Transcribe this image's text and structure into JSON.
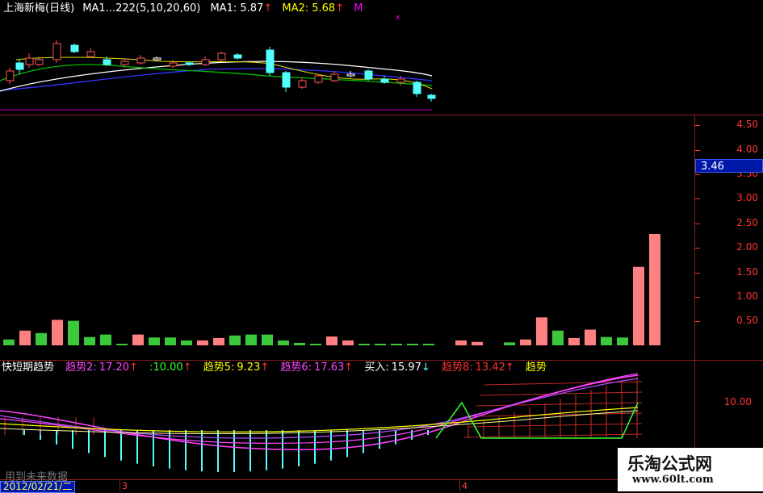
{
  "main_header": {
    "title": "上海新梅(日线)",
    "ma_params": "MA1...222(5,10,20,60)",
    "ma1": "MA1: 5.87",
    "ma1_arrow": "↑",
    "ma2": "MA2: 5.68",
    "ma2_arrow": "↑",
    "ma_more": "M"
  },
  "colors": {
    "bg": "#000000",
    "up": "#ff5555",
    "down": "#54ffff",
    "grid": "#8a1f1f",
    "scale_text": "#ff3333",
    "ma_white": "#ffffff",
    "ma_yellow": "#ffff00",
    "ma_magenta": "#ff00ff",
    "ma_green": "#00c000",
    "ma_blue": "#3333ff",
    "bar_pink": "#ff8080",
    "bar_green": "#3cc83c"
  },
  "volume_scale": {
    "current_value": "3.46",
    "labels": [
      "4.50",
      "4.00",
      "3.50",
      "3.00",
      "2.50",
      "2.00",
      "1.50",
      "1.00",
      "0.50"
    ]
  },
  "volume_bars": [
    {
      "value": 0.12,
      "color": "green"
    },
    {
      "value": 0.3,
      "color": "pink"
    },
    {
      "value": 0.25,
      "color": "green"
    },
    {
      "value": 0.52,
      "color": "pink"
    },
    {
      "value": 0.5,
      "color": "green"
    },
    {
      "value": 0.17,
      "color": "green"
    },
    {
      "value": 0.22,
      "color": "green"
    },
    {
      "value": 0.03,
      "color": "green"
    },
    {
      "value": 0.22,
      "color": "pink"
    },
    {
      "value": 0.16,
      "color": "green"
    },
    {
      "value": 0.16,
      "color": "green"
    },
    {
      "value": 0.1,
      "color": "green"
    },
    {
      "value": 0.1,
      "color": "pink"
    },
    {
      "value": 0.15,
      "color": "pink"
    },
    {
      "value": 0.2,
      "color": "green"
    },
    {
      "value": 0.22,
      "color": "green"
    },
    {
      "value": 0.22,
      "color": "green"
    },
    {
      "value": 0.1,
      "color": "green"
    },
    {
      "value": 0.05,
      "color": "green"
    },
    {
      "value": 0.02,
      "color": "green"
    },
    {
      "value": 0.18,
      "color": "pink"
    },
    {
      "value": 0.1,
      "color": "pink"
    },
    {
      "value": 0.03,
      "color": "green"
    },
    {
      "value": 0.03,
      "color": "green"
    },
    {
      "value": 0.03,
      "color": "green"
    },
    {
      "value": 0.03,
      "color": "green"
    },
    {
      "value": 0.03,
      "color": "green"
    },
    {
      "value": 0.0,
      "color": "green"
    },
    {
      "value": 0.1,
      "color": "pink"
    },
    {
      "value": 0.07,
      "color": "pink"
    },
    {
      "value": 0.0,
      "color": "green"
    },
    {
      "value": 0.06,
      "color": "green"
    },
    {
      "value": 0.12,
      "color": "pink"
    },
    {
      "value": 0.57,
      "color": "pink"
    },
    {
      "value": 0.3,
      "color": "green"
    },
    {
      "value": 0.15,
      "color": "pink"
    },
    {
      "value": 0.32,
      "color": "pink"
    },
    {
      "value": 0.17,
      "color": "green"
    },
    {
      "value": 0.16,
      "color": "green"
    },
    {
      "value": 1.6,
      "color": "pink"
    },
    {
      "value": 2.27,
      "color": "pink"
    }
  ],
  "indicator_header": {
    "title": "快短期趋势",
    "t2_label": "趋势2:",
    "t2_value": "17.20",
    "t2_arrow": "↑",
    "t3_value": ":10.00",
    "t3_arrow": "↑",
    "t5_label": "趋势5:",
    "t5_value": "9.23",
    "t5_arrow": "↑",
    "t6_label": "趋势6:",
    "t6_value": "17.63",
    "t6_arrow": "↑",
    "buy_label": "买入:",
    "buy_value": "15.97",
    "buy_arrow": "↓",
    "t8_label": "趋势8:",
    "t8_value": "13.42",
    "t8_arrow": "↑",
    "t9_label": "趋势"
  },
  "indicator_scale": {
    "label": "10.00"
  },
  "footer": {
    "date": "2012/02/21/二",
    "tick_a": "3",
    "tick_b": "4",
    "no_future": "用到未来数据"
  },
  "watermark": {
    "title": "乐淘公式网",
    "url": "www.60lt.com"
  }
}
